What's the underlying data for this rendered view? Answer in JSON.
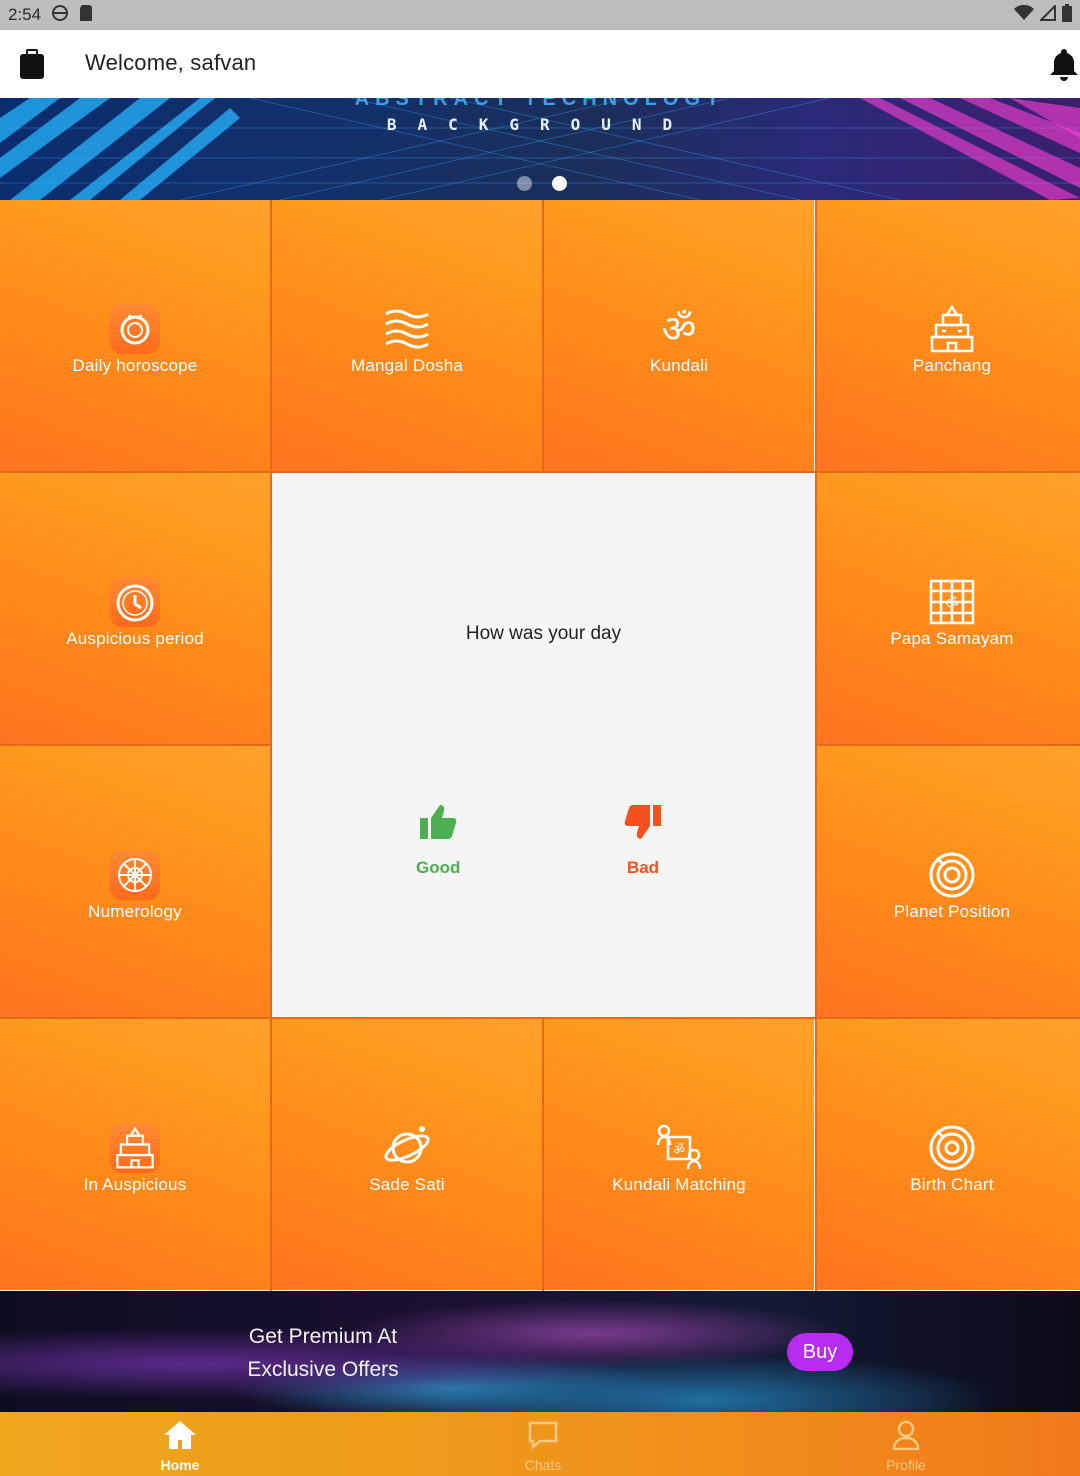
{
  "status_bar": {
    "time": "2:54"
  },
  "header": {
    "welcome_text": "Welcome, safvan"
  },
  "banner": {
    "brand_top": "ABSTRACT TECHNOLOGY",
    "brand_text": "BACKGROUND",
    "carousel_total": 2,
    "carousel_active": 2
  },
  "grid": {
    "tiles": [
      {
        "label": "Daily horoscope",
        "icon": "daily-horoscope-icon"
      },
      {
        "label": "Mangal Dosha",
        "icon": "mangal-dosha-icon"
      },
      {
        "label": "Kundali",
        "icon": "om-icon"
      },
      {
        "label": "Panchang",
        "icon": "temple-icon"
      },
      {
        "label": "Auspicious period",
        "icon": "clock-icon"
      },
      {
        "label": "Papa Samayam",
        "icon": "chart-grid-icon"
      },
      {
        "label": "Numerology",
        "icon": "numerology-wheel-icon"
      },
      {
        "label": "Planet Position",
        "icon": "planet-target-icon"
      },
      {
        "label": "In Auspicious",
        "icon": "temple-icon"
      },
      {
        "label": "Sade Sati",
        "icon": "saturn-icon"
      },
      {
        "label": "Kundali Matching",
        "icon": "kundali-matching-icon"
      },
      {
        "label": "Birth Chart",
        "icon": "birth-chart-icon"
      }
    ]
  },
  "feedback": {
    "question": "How was your day",
    "good_label": "Good",
    "bad_label": "Bad"
  },
  "promo": {
    "line1": "Get Premium At",
    "line2": "Exclusive Offers",
    "buy_label": "Buy"
  },
  "bottom_nav": {
    "home": "Home",
    "chats": "Chats",
    "profile": "Profile"
  },
  "colors": {
    "tile_orange": "#ff8a1a",
    "good_green": "#4caf50",
    "bad_red": "#f4511e",
    "buy_purple": "#b82bf0"
  }
}
